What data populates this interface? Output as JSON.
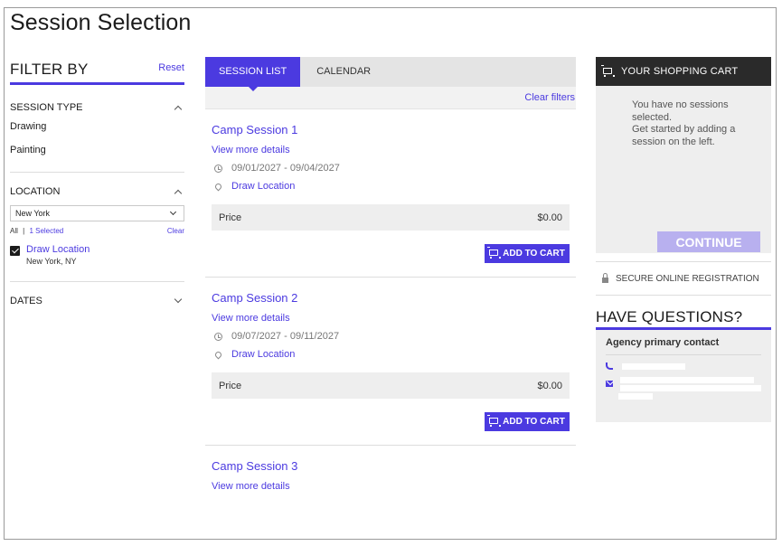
{
  "page": {
    "title": "Session Selection"
  },
  "filters": {
    "title": "FILTER BY",
    "reset": "Reset",
    "session_type": {
      "label": "SESSION TYPE",
      "options": [
        "Drawing",
        "Painting"
      ]
    },
    "location": {
      "label": "LOCATION",
      "selected_value": "New York",
      "all": "All",
      "separator": "|",
      "selected_count": "1 Selected",
      "clear": "Clear",
      "item": {
        "name": "Draw Location",
        "sub": "New York, NY"
      }
    },
    "dates": {
      "label": "DATES"
    }
  },
  "tabs": [
    {
      "label": "SESSION LIST",
      "active": true
    },
    {
      "label": "CALENDAR",
      "active": false
    }
  ],
  "clear_filters": "Clear filters",
  "sessions": [
    {
      "title": "Camp Session 1",
      "details": "View more details",
      "dates": "09/01/2027 - 09/04/2027",
      "location": "Draw Location",
      "price_label": "Price",
      "price": "$0.00",
      "add": "ADD TO CART"
    },
    {
      "title": "Camp Session 2",
      "details": "View more details",
      "dates": "09/07/2027 - 09/11/2027",
      "location": "Draw Location",
      "price_label": "Price",
      "price": "$0.00",
      "add": "ADD TO CART"
    },
    {
      "title": "Camp Session 3",
      "details": "View more details"
    }
  ],
  "cart": {
    "title": "YOUR SHOPPING CART",
    "empty_line1": "You have no sessions",
    "empty_line2": "selected.",
    "empty_line3": "Get started by adding a",
    "empty_line4": "session on the left.",
    "continue": "CONTINUE"
  },
  "secure": "SECURE ONLINE REGISTRATION",
  "questions": {
    "title": "HAVE QUESTIONS?",
    "contact_title": "Agency primary contact"
  },
  "colors": {
    "accent": "#4b3ae0",
    "cart_header": "#2a2a2a",
    "continue_disabled": "#b8b0ef"
  },
  "icons": [
    "chevron-up-icon",
    "chevron-down-icon",
    "checkbox-checked-icon",
    "clock-icon",
    "location-pin-icon",
    "cart-icon",
    "lock-icon",
    "phone-icon",
    "mail-icon"
  ]
}
